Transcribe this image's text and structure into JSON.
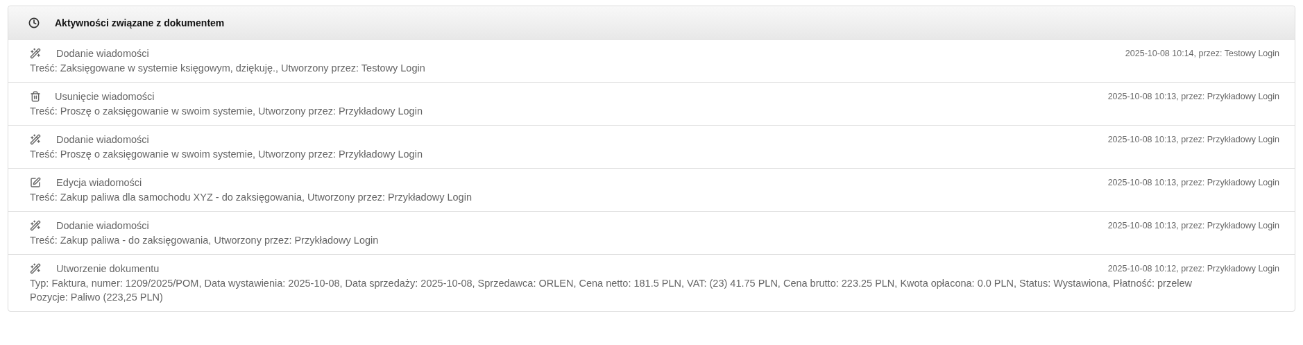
{
  "panel": {
    "title": "Aktywności związane z dokumentem"
  },
  "activities": [
    {
      "kind": "add",
      "title": "Dodanie wiadomości",
      "meta": "2025-10-08 10:14, przez: Testowy Login",
      "details": [
        "Treść: Zaksięgowane w systemie księgowym, dziękuję., Utworzony przez: Testowy Login"
      ]
    },
    {
      "kind": "delete",
      "title": "Usunięcie wiadomości",
      "meta": "2025-10-08 10:13, przez: Przykładowy Login",
      "details": [
        "Treść: Proszę o zaksięgowanie w swoim systemie, Utworzony przez: Przykładowy Login"
      ]
    },
    {
      "kind": "add",
      "title": "Dodanie wiadomości",
      "meta": "2025-10-08 10:13, przez: Przykładowy Login",
      "details": [
        "Treść: Proszę o zaksięgowanie w swoim systemie, Utworzony przez: Przykładowy Login"
      ]
    },
    {
      "kind": "edit",
      "title": "Edycja wiadomości",
      "meta": "2025-10-08 10:13, przez: Przykładowy Login",
      "details": [
        "Treść: Zakup paliwa dla samochodu XYZ - do zaksięgowania, Utworzony przez: Przykładowy Login"
      ]
    },
    {
      "kind": "add",
      "title": "Dodanie wiadomości",
      "meta": "2025-10-08 10:13, przez: Przykładowy Login",
      "details": [
        "Treść: Zakup paliwa - do zaksięgowania, Utworzony przez: Przykładowy Login"
      ]
    },
    {
      "kind": "add",
      "title": "Utworzenie dokumentu",
      "meta": "2025-10-08 10:12, przez: Przykładowy Login",
      "details": [
        "Typ: Faktura, numer: 1209/2025/POM, Data wystawienia: 2025-10-08, Data sprzedaży: 2025-10-08, Sprzedawca: ORLEN, Cena netto: 181.5 PLN, VAT: (23) 41.75 PLN, Cena brutto: 223.25 PLN, Kwota opłacona: 0.0 PLN, Status: Wystawiona, Płatność: przelew",
        "Pozycje: Paliwo (223,25 PLN)"
      ]
    }
  ]
}
